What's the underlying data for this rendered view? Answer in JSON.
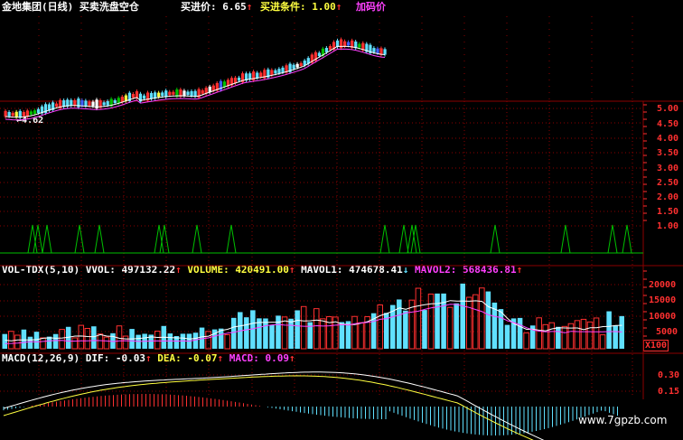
{
  "main_header": {
    "stock": "金地集团",
    "period": "(日线)",
    "indicator": "买卖洗盘空仓",
    "buy_price_label": "买进价:",
    "buy_price_value": "6.65",
    "buy_cond_label": "买进条件:",
    "buy_cond_value": "1.00",
    "add_label": "加码价"
  },
  "price_annotation": "4.62",
  "main_axis": [
    "5.00",
    "4.50",
    "4.00",
    "3.50",
    "3.00",
    "2.50",
    "2.00",
    "1.50",
    "1.00"
  ],
  "vol_header": {
    "name": "VOL-TDX(5,10)",
    "vvol_label": "VVOL:",
    "vvol_value": "497132.22",
    "volume_label": "VOLUME:",
    "volume_value": "420491.00",
    "mavol1_label": "MAVOL1:",
    "mavol1_value": "474678.41",
    "mavol2_label": "MAVOL2:",
    "mavol2_value": "568436.81"
  },
  "vol_axis": [
    "20000",
    "15000",
    "10000",
    "5000",
    "X100"
  ],
  "macd_header": {
    "name": "MACD(12,26,9)",
    "dif_label": "DIF:",
    "dif_value": "-0.03",
    "dea_label": "DEA:",
    "dea_value": "-0.07",
    "macd_label": "MACD:",
    "macd_value": "0.09"
  },
  "macd_axis": [
    "0.30",
    "0.15"
  ],
  "watermark": "www.7gpzb.com",
  "colors": {
    "background": "#000000",
    "up": "#ff3030",
    "down": "#60e0ff",
    "grid": "#8b0000",
    "signal": "#00c000",
    "white": "#ffffff",
    "yellow": "#ffff40",
    "magenta": "#ff40ff"
  }
}
